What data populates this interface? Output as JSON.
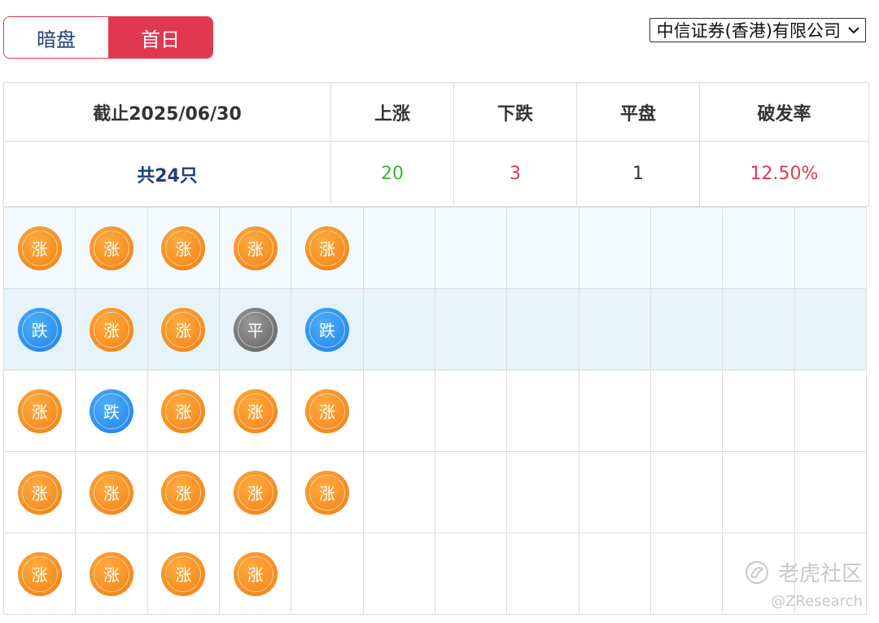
{
  "toggle": {
    "options": [
      "暗盘",
      "首日"
    ],
    "selected": "首日"
  },
  "broker": {
    "selected": "中信证券(香港)有限公司"
  },
  "summary": {
    "date_header": "截止2025/06/30",
    "up_header": "上涨",
    "down_header": "下跌",
    "flat_header": "平盘",
    "rate_header": "破发率",
    "total": "共24只",
    "up": "20",
    "down": "3",
    "flat": "1",
    "rate": "12.50%"
  },
  "coin_labels": {
    "up": "涨",
    "down": "跌",
    "flat": "平"
  },
  "grid": [
    [
      "up",
      "up",
      "up",
      "up",
      "up"
    ],
    [
      "down",
      "up",
      "up",
      "flat",
      "down"
    ],
    [
      "up",
      "down",
      "up",
      "up",
      "up"
    ],
    [
      "up",
      "up",
      "up",
      "up",
      "up"
    ],
    [
      "up",
      "up",
      "up",
      "up"
    ]
  ],
  "colors": {
    "accent_red": "#e0394f",
    "up_green": "#3cb52e",
    "coin_up": "#f7901e",
    "coin_down": "#2b8ff0",
    "coin_flat": "#7a7a7a",
    "navy": "#1f3f7a"
  },
  "watermark": {
    "brand": "老虎社区",
    "handle": "@ZResearch"
  }
}
